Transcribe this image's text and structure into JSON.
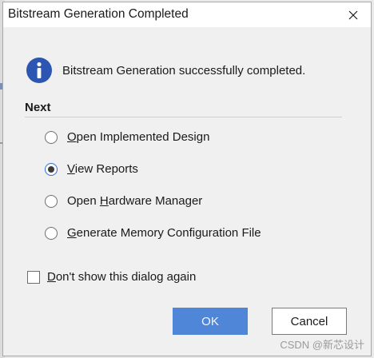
{
  "dialog": {
    "title": "Bitstream Generation Completed",
    "message": "Bitstream Generation successfully completed.",
    "section_title": "Next",
    "options": [
      {
        "before": "",
        "mnemonic": "O",
        "after": "pen Implemented Design",
        "checked": false
      },
      {
        "before": "",
        "mnemonic": "V",
        "after": "iew Reports",
        "checked": true
      },
      {
        "before": "Open ",
        "mnemonic": "H",
        "after": "ardware Manager",
        "checked": false
      },
      {
        "before": "",
        "mnemonic": "G",
        "after": "enerate Memory Configuration File",
        "checked": false
      }
    ],
    "dont_show": {
      "mnemonic": "D",
      "after": "on't show this dialog again",
      "checked": false
    },
    "ok_label": "OK",
    "cancel_label": "Cancel"
  },
  "watermark": "CSDN @新芯设计",
  "icons": {
    "info": "info-icon",
    "close": "close-icon"
  },
  "colors": {
    "info_icon": "#2d56b3",
    "ok_button": "#4f86d8",
    "radio_selected_ring": "#2b6ed9"
  }
}
